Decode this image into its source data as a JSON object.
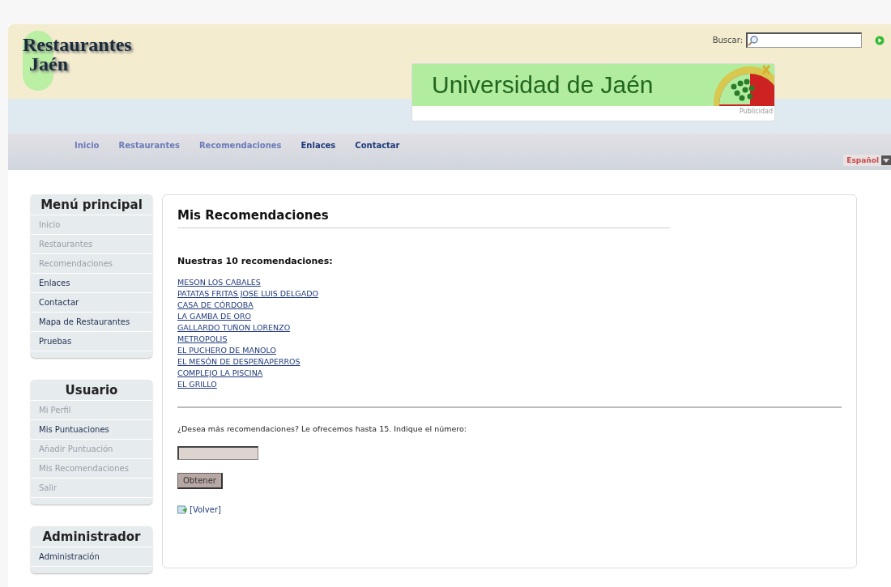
{
  "logo": {
    "line1": "Restaurantes",
    "line2": "Jaén"
  },
  "search": {
    "label": "Buscar:"
  },
  "banner": {
    "title": "Universidad de Jaén",
    "caption": "Publicidad"
  },
  "nav": [
    {
      "label": "Inicio",
      "visited": true
    },
    {
      "label": "Restaurantes",
      "visited": true
    },
    {
      "label": "Recomendaciones",
      "visited": true
    },
    {
      "label": "Enlaces",
      "visited": false
    },
    {
      "label": "Contactar",
      "visited": false
    }
  ],
  "language": {
    "value": "Español"
  },
  "sidebar": [
    {
      "title": "Menú principal",
      "items": [
        {
          "label": "Inicio",
          "visited": true
        },
        {
          "label": "Restaurantes",
          "visited": true
        },
        {
          "label": "Recomendaciones",
          "visited": true
        },
        {
          "label": "Enlaces",
          "visited": false
        },
        {
          "label": "Contactar",
          "visited": false
        },
        {
          "label": "Mapa de Restaurantes",
          "visited": false
        },
        {
          "label": "Pruebas",
          "visited": false
        }
      ]
    },
    {
      "title": "Usuario",
      "items": [
        {
          "label": "Mi Perfil",
          "visited": true
        },
        {
          "label": "Mis Puntuaciones",
          "visited": false
        },
        {
          "label": "Añadir Puntuación",
          "visited": true
        },
        {
          "label": "Mis Recomendaciones",
          "visited": true
        },
        {
          "label": "Salir",
          "visited": true
        }
      ]
    },
    {
      "title": "Administrador",
      "items": [
        {
          "label": "Administración",
          "visited": false
        }
      ]
    }
  ],
  "main": {
    "title": "Mis Recomendaciones",
    "subtitle": "Nuestras 10 recomendaciones:",
    "recommendations": [
      "MESON LOS CABALES",
      "PATATAS FRITAS JOSE LUIS DELGADO",
      "CASA DE CÓRDOBA",
      "LA GAMBA DE ORO",
      "GALLARDO TUÑON LORENZO",
      "METROPOLIS",
      "EL PUCHERO DE MANOLO",
      "EL MESÓN DE DESPEÑAPERROS",
      "COMPLEJO LA PISCINA",
      "EL GRILLO"
    ],
    "question": "¿Desea más recomendaciones? Le ofrecemos hasta 15. Indique el número:",
    "button": "Obtener",
    "back": "[Volver]"
  }
}
